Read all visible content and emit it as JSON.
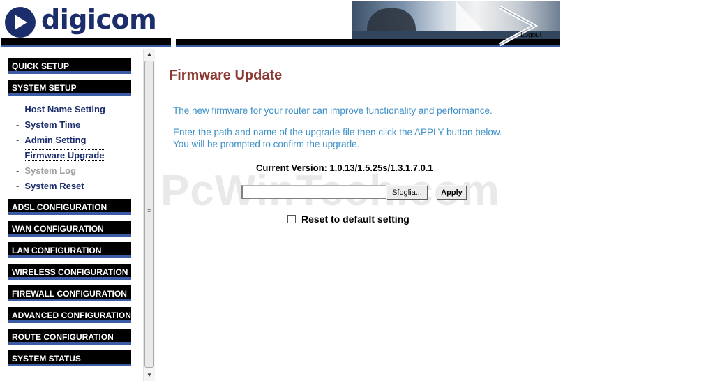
{
  "header": {
    "logo_text": "digicom",
    "logout_label": "Logout"
  },
  "sidebar": {
    "menus": [
      {
        "label": "QUICK SETUP"
      },
      {
        "label": "SYSTEM SETUP"
      },
      {
        "label": "ADSL CONFIGURATION"
      },
      {
        "label": "WAN CONFIGURATION"
      },
      {
        "label": "LAN CONFIGURATION"
      },
      {
        "label": "WIRELESS CONFIGURATION"
      },
      {
        "label": "FIREWALL CONFIGURATION"
      },
      {
        "label": "ADVANCED CONFIGURATION"
      },
      {
        "label": "ROUTE CONFIGURATION"
      },
      {
        "label": "SYSTEM STATUS"
      }
    ],
    "system_setup_items": [
      {
        "label": "Host Name Setting",
        "state": "normal"
      },
      {
        "label": "System Time",
        "state": "normal"
      },
      {
        "label": "Admin Setting",
        "state": "normal"
      },
      {
        "label": "Firmware Upgrade",
        "state": "active"
      },
      {
        "label": "System Log",
        "state": "disabled"
      },
      {
        "label": "System Reset",
        "state": "normal"
      }
    ],
    "dash": "-"
  },
  "main": {
    "title": "Firmware Update",
    "description_line1": "The new firmware for your router can improve functionality and performance.",
    "description_line2": "Enter the path and name of the upgrade file then click the APPLY button below.",
    "description_line3": "You will be prompted to confirm the upgrade.",
    "current_version_label": "Current Version:",
    "current_version_value": "1.0.13/1.5.25s/1.3.1.7.0.1",
    "file_input_value": "",
    "browse_label": "Sfoglia...",
    "apply_label": "Apply",
    "reset_checkbox_checked": false,
    "reset_label": "Reset to default setting"
  },
  "watermark": "PcWinTech.com",
  "colors": {
    "brand_navy": "#1c2d6c",
    "accent_blue": "#3b5ba4",
    "title_red": "#8a3a32",
    "description_blue": "#3d90c8"
  }
}
